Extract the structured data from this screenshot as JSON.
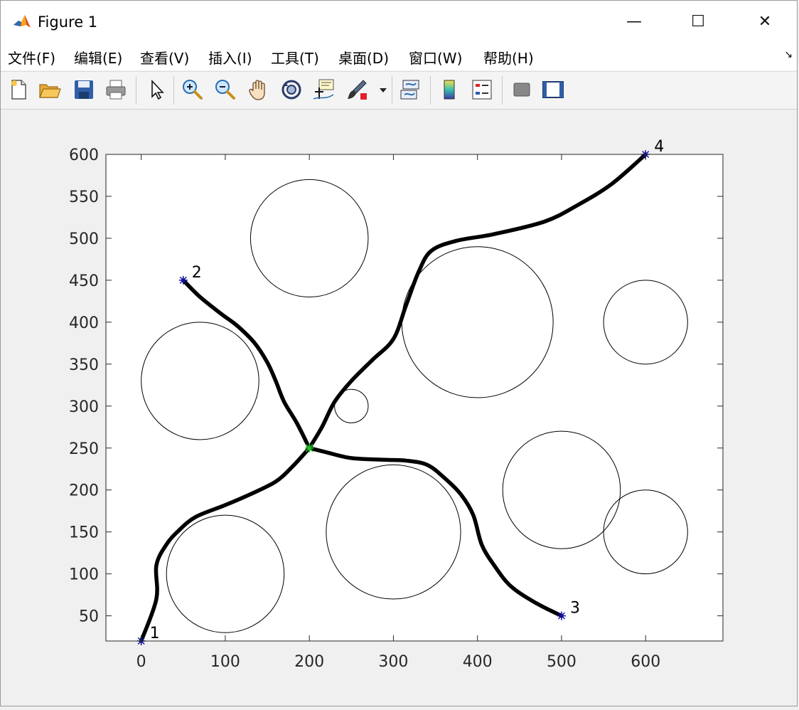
{
  "window": {
    "title": "Figure 1",
    "minimize": "—",
    "maximize": "☐",
    "close": "✕"
  },
  "menu": {
    "items": [
      "文件(F)",
      "编辑(E)",
      "查看(V)",
      "插入(I)",
      "工具(T)",
      "桌面(D)",
      "窗口(W)",
      "帮助(H)"
    ],
    "more": "↘"
  },
  "toolbar": {
    "icons": [
      "new-figure-icon",
      "open-file-icon",
      "save-icon",
      "print-icon",
      "pointer-icon",
      "zoom-in-icon",
      "zoom-out-icon",
      "pan-hand-icon",
      "rotate-3d-icon",
      "data-cursor-icon",
      "brush-icon",
      "link-plot-icon",
      "colorbar-icon",
      "legend-icon",
      "hide-plot-tools-icon",
      "show-plot-tools-icon"
    ]
  },
  "chart_data": {
    "type": "line",
    "xlim": [
      -42,
      692
    ],
    "ylim": [
      20,
      600
    ],
    "xticks": [
      0,
      100,
      200,
      300,
      400,
      500,
      600
    ],
    "yticks": [
      50,
      100,
      150,
      200,
      250,
      300,
      350,
      400,
      450,
      500,
      550,
      600
    ],
    "grid": false,
    "obstacles": [
      {
        "cx": 200,
        "cy": 500,
        "r": 70
      },
      {
        "cx": 400,
        "cy": 400,
        "r": 90
      },
      {
        "cx": 600,
        "cy": 400,
        "r": 50
      },
      {
        "cx": 70,
        "cy": 330,
        "r": 70
      },
      {
        "cx": 250,
        "cy": 300,
        "r": 20
      },
      {
        "cx": 300,
        "cy": 150,
        "r": 80
      },
      {
        "cx": 500,
        "cy": 200,
        "r": 70
      },
      {
        "cx": 600,
        "cy": 150,
        "r": 50
      },
      {
        "cx": 100,
        "cy": 100,
        "r": 70
      }
    ],
    "points": [
      {
        "label": "1",
        "x": 0,
        "y": 20
      },
      {
        "label": "2",
        "x": 50,
        "y": 450
      },
      {
        "label": "3",
        "x": 500,
        "y": 50
      },
      {
        "label": "4",
        "x": 600,
        "y": 600
      }
    ],
    "center": {
      "x": 200,
      "y": 250
    },
    "paths": [
      {
        "points": [
          [
            0,
            20
          ],
          [
            18,
            70
          ],
          [
            18,
            110
          ],
          [
            30,
            135
          ],
          [
            45,
            152
          ],
          [
            65,
            168
          ],
          [
            100,
            182
          ],
          [
            130,
            195
          ],
          [
            160,
            210
          ],
          [
            180,
            228
          ],
          [
            200,
            250
          ]
        ]
      },
      {
        "points": [
          [
            50,
            450
          ],
          [
            70,
            430
          ],
          [
            95,
            410
          ],
          [
            115,
            395
          ],
          [
            135,
            375
          ],
          [
            150,
            352
          ],
          [
            160,
            330
          ],
          [
            170,
            305
          ],
          [
            185,
            280
          ],
          [
            200,
            250
          ]
        ]
      },
      {
        "points": [
          [
            200,
            250
          ],
          [
            220,
            245
          ],
          [
            250,
            238
          ],
          [
            290,
            236
          ],
          [
            315,
            235
          ],
          [
            340,
            230
          ],
          [
            360,
            215
          ],
          [
            380,
            195
          ],
          [
            395,
            170
          ],
          [
            405,
            135
          ],
          [
            420,
            110
          ],
          [
            440,
            85
          ],
          [
            470,
            65
          ],
          [
            500,
            50
          ]
        ]
      },
      {
        "points": [
          [
            200,
            250
          ],
          [
            215,
            275
          ],
          [
            230,
            305
          ],
          [
            250,
            330
          ],
          [
            275,
            355
          ],
          [
            300,
            380
          ],
          [
            315,
            420
          ],
          [
            330,
            460
          ],
          [
            345,
            485
          ],
          [
            375,
            497
          ],
          [
            420,
            505
          ],
          [
            480,
            520
          ],
          [
            520,
            540
          ],
          [
            560,
            565
          ],
          [
            600,
            600
          ]
        ]
      }
    ]
  }
}
